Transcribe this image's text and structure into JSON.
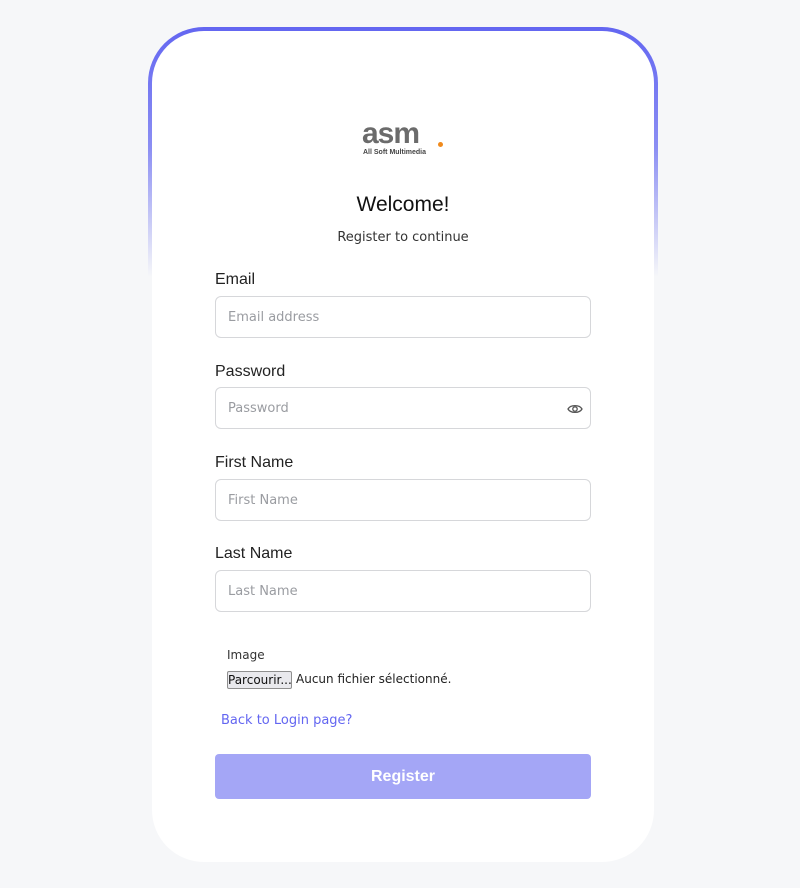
{
  "brand": {
    "logo_word": "asm",
    "logo_tagline": "All Soft Multimedia"
  },
  "header": {
    "title": "Welcome!",
    "subtitle": "Register to continue"
  },
  "form": {
    "email": {
      "label": "Email",
      "placeholder": "Email address",
      "value": ""
    },
    "password": {
      "label": "Password",
      "placeholder": "Password",
      "value": "",
      "icon": "eye-icon"
    },
    "first_name": {
      "label": "First Name",
      "placeholder": "First Name",
      "value": ""
    },
    "last_name": {
      "label": "Last Name",
      "placeholder": "Last Name",
      "value": ""
    },
    "image": {
      "label": "Image",
      "button_label": "Parcourir...",
      "status": "Aucun fichier sélectionné."
    }
  },
  "links": {
    "back_to_login": "Back to Login page?"
  },
  "actions": {
    "register_label": "Register"
  },
  "colors": {
    "accent": "#6366f1",
    "button_disabled": "#a4a6f6",
    "background": "#f6f7f9",
    "logo_dot": "#f08a1c"
  }
}
